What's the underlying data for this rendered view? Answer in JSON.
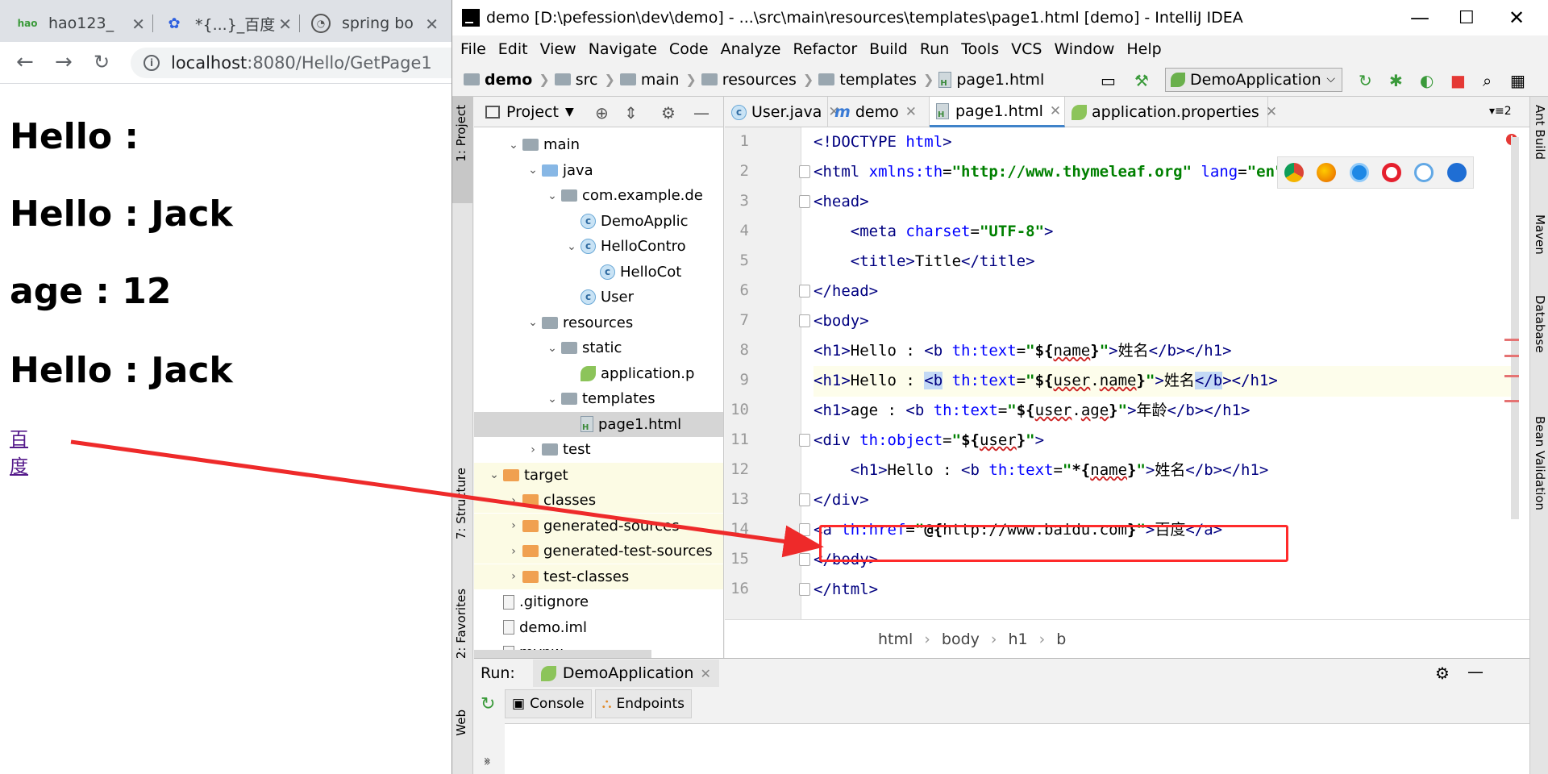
{
  "browser": {
    "tabs": [
      {
        "label": "hao123_",
        "icon": "hao-icon"
      },
      {
        "label": "*{...}_百度",
        "icon": "baidu-paw-icon"
      },
      {
        "label": "spring bo",
        "icon": "spring-doc-icon"
      }
    ],
    "url_host": "localhost",
    "url_path": ":8080/Hello/GetPage1",
    "page": {
      "h1": [
        "Hello :",
        "Hello : Jack",
        "age : 12",
        "Hello : Jack"
      ],
      "link": "百度"
    }
  },
  "ide": {
    "title": "demo [D:\\pefession\\dev\\demo] - ...\\src\\main\\resources\\templates\\page1.html [demo] - IntelliJ IDEA",
    "menu": [
      "File",
      "Edit",
      "View",
      "Navigate",
      "Code",
      "Analyze",
      "Refactor",
      "Build",
      "Run",
      "Tools",
      "VCS",
      "Window",
      "Help"
    ],
    "breadcrumbs": [
      "demo",
      "src",
      "main",
      "resources",
      "templates",
      "page1.html"
    ],
    "run_config": "DemoApplication",
    "left_tools": [
      "1: Project",
      "7: Structure",
      "2: Favorites",
      "Web"
    ],
    "right_tools": [
      "Ant Build",
      "Maven",
      "Database",
      "Bean Validation"
    ],
    "project_panel": {
      "title": "Project",
      "tree": [
        {
          "label": "main",
          "arrow": "v",
          "indent": 2,
          "icon": "folder"
        },
        {
          "label": "java",
          "arrow": "v",
          "indent": 3,
          "icon": "folder-blue"
        },
        {
          "label": "com.example.de",
          "arrow": "v",
          "indent": 4,
          "icon": "folder"
        },
        {
          "label": "DemoApplic",
          "arrow": "",
          "indent": 5,
          "icon": "class"
        },
        {
          "label": "HelloContro",
          "arrow": "v",
          "indent": 5,
          "icon": "class",
          "arrow_at": 4
        },
        {
          "label": "HelloCot",
          "arrow": "",
          "indent": 6,
          "icon": "class"
        },
        {
          "label": "User",
          "arrow": "",
          "indent": 5,
          "icon": "class"
        },
        {
          "label": "resources",
          "arrow": "v",
          "indent": 3,
          "icon": "folder-res"
        },
        {
          "label": "static",
          "arrow": "v",
          "indent": 4,
          "icon": "folder"
        },
        {
          "label": "application.p",
          "arrow": "",
          "indent": 5,
          "icon": "prop"
        },
        {
          "label": "templates",
          "arrow": "v",
          "indent": 4,
          "icon": "folder"
        },
        {
          "label": "page1.html",
          "arrow": "",
          "indent": 5,
          "icon": "html",
          "selected": true
        },
        {
          "label": "test",
          "arrow": ">",
          "indent": 3,
          "icon": "folder"
        },
        {
          "label": "target",
          "arrow": "v",
          "indent": 1,
          "icon": "folder-orange",
          "excluded": true
        },
        {
          "label": "classes",
          "arrow": ">",
          "indent": 2,
          "icon": "folder-orange",
          "excluded": true
        },
        {
          "label": "generated-sources",
          "arrow": ">",
          "indent": 2,
          "icon": "folder-orange",
          "excluded": true
        },
        {
          "label": "generated-test-sources",
          "arrow": ">",
          "indent": 2,
          "icon": "folder-orange",
          "excluded": true
        },
        {
          "label": "test-classes",
          "arrow": ">",
          "indent": 2,
          "icon": "folder-orange",
          "excluded": true
        },
        {
          "label": ".gitignore",
          "arrow": "",
          "indent": 1,
          "icon": "file"
        },
        {
          "label": "demo.iml",
          "arrow": "",
          "indent": 1,
          "icon": "file"
        },
        {
          "label": "mvnw",
          "arrow": "",
          "indent": 1,
          "icon": "file"
        }
      ]
    },
    "editor_tabs": [
      {
        "label": "User.java",
        "icon": "class"
      },
      {
        "label": "demo",
        "icon": "maven-m"
      },
      {
        "label": "page1.html",
        "icon": "html",
        "active": true
      },
      {
        "label": "application.properties",
        "icon": "prop"
      }
    ],
    "tab_count": "2",
    "line_numbers": [
      "1",
      "2",
      "3",
      "4",
      "5",
      "6",
      "7",
      "8",
      "9",
      "10",
      "11",
      "12",
      "13",
      "14",
      "15",
      "16"
    ],
    "editor_breadcrumb": [
      "html",
      "body",
      "h1",
      "b"
    ],
    "run": {
      "label": "Run:",
      "config_tab": "DemoApplication",
      "subtabs": [
        "Console",
        "Endpoints"
      ]
    }
  }
}
